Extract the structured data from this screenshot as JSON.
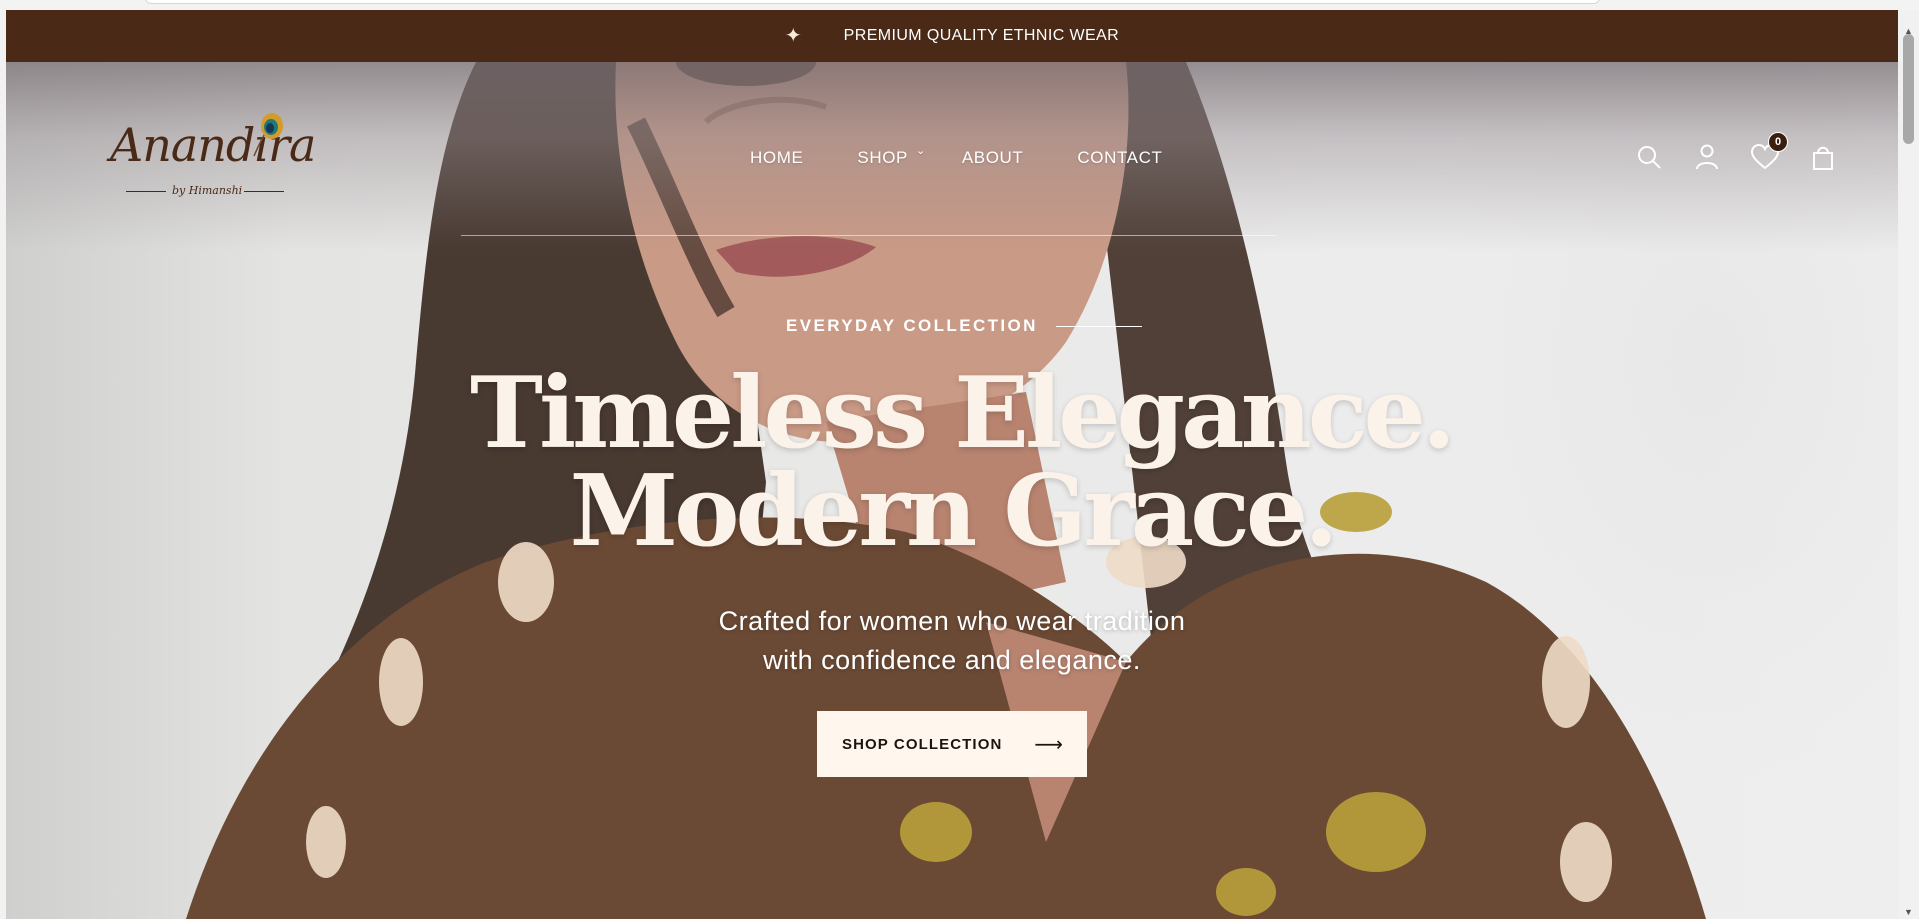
{
  "announcement": {
    "icon": "sparkle-icon",
    "text": "PREMIUM QUALITY ETHNIC WEAR"
  },
  "logo": {
    "brand": "Anandira",
    "tagline": "by Himanshi",
    "icon": "peacock-feather-icon"
  },
  "nav": {
    "items": [
      {
        "label": "HOME"
      },
      {
        "label": "SHOP",
        "has_dropdown": true
      },
      {
        "label": "ABOUT"
      },
      {
        "label": "CONTACT"
      }
    ]
  },
  "header_icons": {
    "search": "search-icon",
    "account": "user-icon",
    "wishlist": "heart-icon",
    "wishlist_count": "0",
    "cart": "shopping-bag-icon"
  },
  "hero": {
    "eyebrow": "EVERYDAY COLLECTION",
    "headline_line1": "Timeless Elegance.",
    "headline_line2": "Modern Grace.",
    "subtitle_line1": "Crafted for women who wear tradition",
    "subtitle_line2": "with confidence and elegance.",
    "cta_label": "SHOP COLLECTION",
    "cta_icon": "arrow-right-icon"
  },
  "colors": {
    "announcement_bg": "#4a2a17",
    "brand": "#4a2a17",
    "cta_bg": "#fff7ee",
    "headline": "#fbf3ea"
  }
}
